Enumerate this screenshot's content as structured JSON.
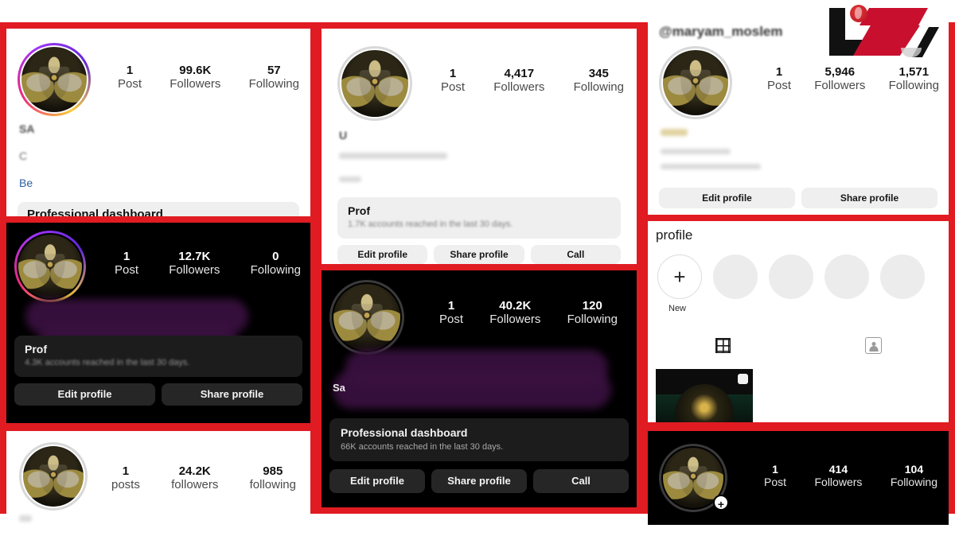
{
  "meta": {
    "background_color": "#e01b22",
    "watermark_name": "news-agency-logo"
  },
  "panels": [
    {
      "id": "top-left",
      "theme": "light",
      "stats": [
        {
          "num": "1",
          "label": "Post"
        },
        {
          "num": "99.6K",
          "label": "Followers"
        },
        {
          "num": "57",
          "label": "Following"
        }
      ],
      "bio_fragments": [
        "SA",
        "C",
        "Be"
      ],
      "dashboard": {
        "title": "Professional dashboard",
        "subtitle": ""
      },
      "buttons": []
    },
    {
      "id": "top-middle",
      "theme": "light",
      "stats": [
        {
          "num": "1",
          "label": "Post"
        },
        {
          "num": "4,417",
          "label": "Followers"
        },
        {
          "num": "345",
          "label": "Following"
        }
      ],
      "bio_fragments": [
        "U"
      ],
      "dashboard": {
        "title": "Prof",
        "subtitle": "1.7K accounts reached in the last 30 days."
      },
      "buttons": [
        "Edit profile",
        "Share profile",
        "Call"
      ]
    },
    {
      "id": "top-right",
      "theme": "light",
      "username": "@maryam_moslem",
      "stats": [
        {
          "num": "1",
          "label": "Post"
        },
        {
          "num": "5,946",
          "label": "Followers"
        },
        {
          "num": "1,571",
          "label": "Following"
        }
      ],
      "bio_fragments": [
        ""
      ],
      "buttons": [
        "Edit profile",
        "Share profile"
      ]
    },
    {
      "id": "mid-left",
      "theme": "dark",
      "stats": [
        {
          "num": "1",
          "label": "Post"
        },
        {
          "num": "12.7K",
          "label": "Followers"
        },
        {
          "num": "0",
          "label": "Following"
        }
      ],
      "dashboard": {
        "title": "Prof",
        "subtitle": "4.3K accounts reached in the last 30 days."
      },
      "buttons": [
        "Edit profile",
        "Share profile"
      ]
    },
    {
      "id": "center",
      "theme": "dark",
      "stats": [
        {
          "num": "1",
          "label": "Post"
        },
        {
          "num": "40.2K",
          "label": "Followers"
        },
        {
          "num": "120",
          "label": "Following"
        }
      ],
      "bio_fragments": [
        "Sa"
      ],
      "dashboard": {
        "title": "Professional dashboard",
        "subtitle": "66K accounts reached in the last 30 days."
      },
      "buttons": [
        "Edit profile",
        "Share profile",
        "Call"
      ]
    },
    {
      "id": "mid-right",
      "theme": "light",
      "heading": "profile",
      "highlight_new_label": "New",
      "highlight_count": 4,
      "tabs": [
        "grid-icon",
        "tagged-icon"
      ]
    },
    {
      "id": "bottom-left",
      "theme": "light",
      "stats": [
        {
          "num": "1",
          "label": "posts"
        },
        {
          "num": "24.2K",
          "label": "followers"
        },
        {
          "num": "985",
          "label": "following"
        }
      ]
    },
    {
      "id": "bottom-right",
      "theme": "dark",
      "stats": [
        {
          "num": "1",
          "label": "Post"
        },
        {
          "num": "414",
          "label": "Followers"
        },
        {
          "num": "104",
          "label": "Following"
        }
      ],
      "avatar_badge": "+"
    }
  ]
}
